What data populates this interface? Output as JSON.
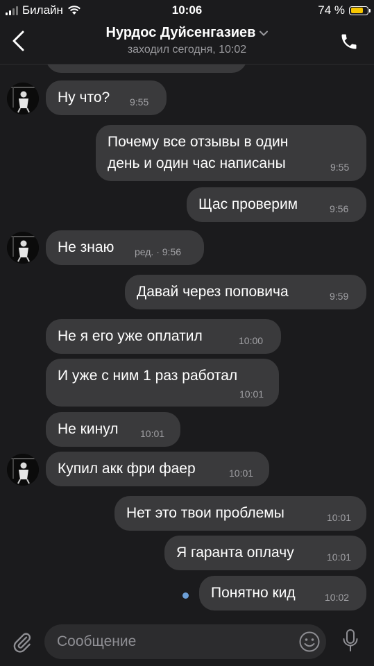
{
  "status_bar": {
    "carrier": "Билайн",
    "time": "10:06",
    "battery_percent": "74 %"
  },
  "header": {
    "contact_name": "Нурдос Дуйсенгазиев",
    "last_seen": "заходил сегодня, 10:02"
  },
  "messages": [
    {
      "text": "Ну что?",
      "time": "9:55",
      "side": "in"
    },
    {
      "text": "Почему все отзывы в один\nдень и один час написаны",
      "time": "9:55",
      "side": "out"
    },
    {
      "text": "Щас проверим",
      "time": "9:56",
      "side": "out"
    },
    {
      "text": "Не знаю",
      "time": "ред. · 9:56",
      "side": "in"
    },
    {
      "text": "Давай через поповича",
      "time": "9:59",
      "side": "out"
    },
    {
      "text": "Не я его уже оплатил",
      "time": "10:00",
      "side": "in"
    },
    {
      "text": "И уже с ним 1 раз работал",
      "time": "10:01",
      "side": "in"
    },
    {
      "text": "Не кинул",
      "time": "10:01",
      "side": "in"
    },
    {
      "text": "Купил акк фри фаер",
      "time": "10:01",
      "side": "in"
    },
    {
      "text": "Нет это твои проблемы",
      "time": "10:01",
      "side": "out"
    },
    {
      "text": "Я гаранта оплачу",
      "time": "10:01",
      "side": "out"
    },
    {
      "text": "Понятно кид",
      "time": "10:02",
      "side": "out",
      "unread": true
    }
  ],
  "composer": {
    "placeholder": "Сообщение"
  },
  "colors": {
    "background": "#1b1b1d",
    "bubble": "#3a3a3c",
    "unread_dot": "#6d9fd6",
    "battery": "#f7c600"
  }
}
